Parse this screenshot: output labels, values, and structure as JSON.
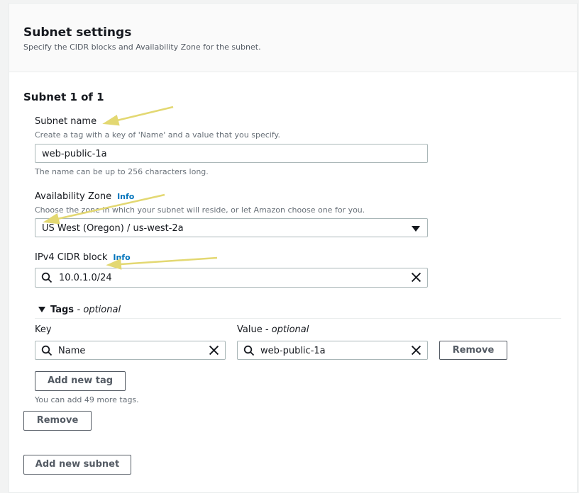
{
  "section": {
    "title": "Subnet settings",
    "description": "Specify the CIDR blocks and Availability Zone for the subnet."
  },
  "subnet": {
    "heading": "Subnet 1 of 1",
    "name": {
      "label": "Subnet name",
      "description": "Create a tag with a key of 'Name' and a value that you specify.",
      "value": "web-public-1a",
      "hint": "The name can be up to 256 characters long."
    },
    "az": {
      "label": "Availability Zone",
      "info": "Info",
      "description": "Choose the zone in which your subnet will reside, or let Amazon choose one for you.",
      "value": "US West (Oregon) / us-west-2a"
    },
    "cidr": {
      "label": "IPv4 CIDR block",
      "info": "Info",
      "value": "10.0.1.0/24"
    },
    "tags": {
      "toggle_label": "Tags",
      "toggle_optional": "- optional",
      "key_header": "Key",
      "value_header": "Value",
      "value_optional": "- optional",
      "key_value": "Name",
      "value_value": "web-public-1a",
      "remove_label": "Remove",
      "add_tag_label": "Add new tag",
      "remaining_hint": "You can add 49 more tags."
    },
    "remove_subnet_label": "Remove"
  },
  "add_subnet_label": "Add new subnet",
  "colors": {
    "accent_link": "#0073bb",
    "annotation_arrow": "#e3d872",
    "border": "#aab7b8",
    "button_text": "#545b64"
  }
}
